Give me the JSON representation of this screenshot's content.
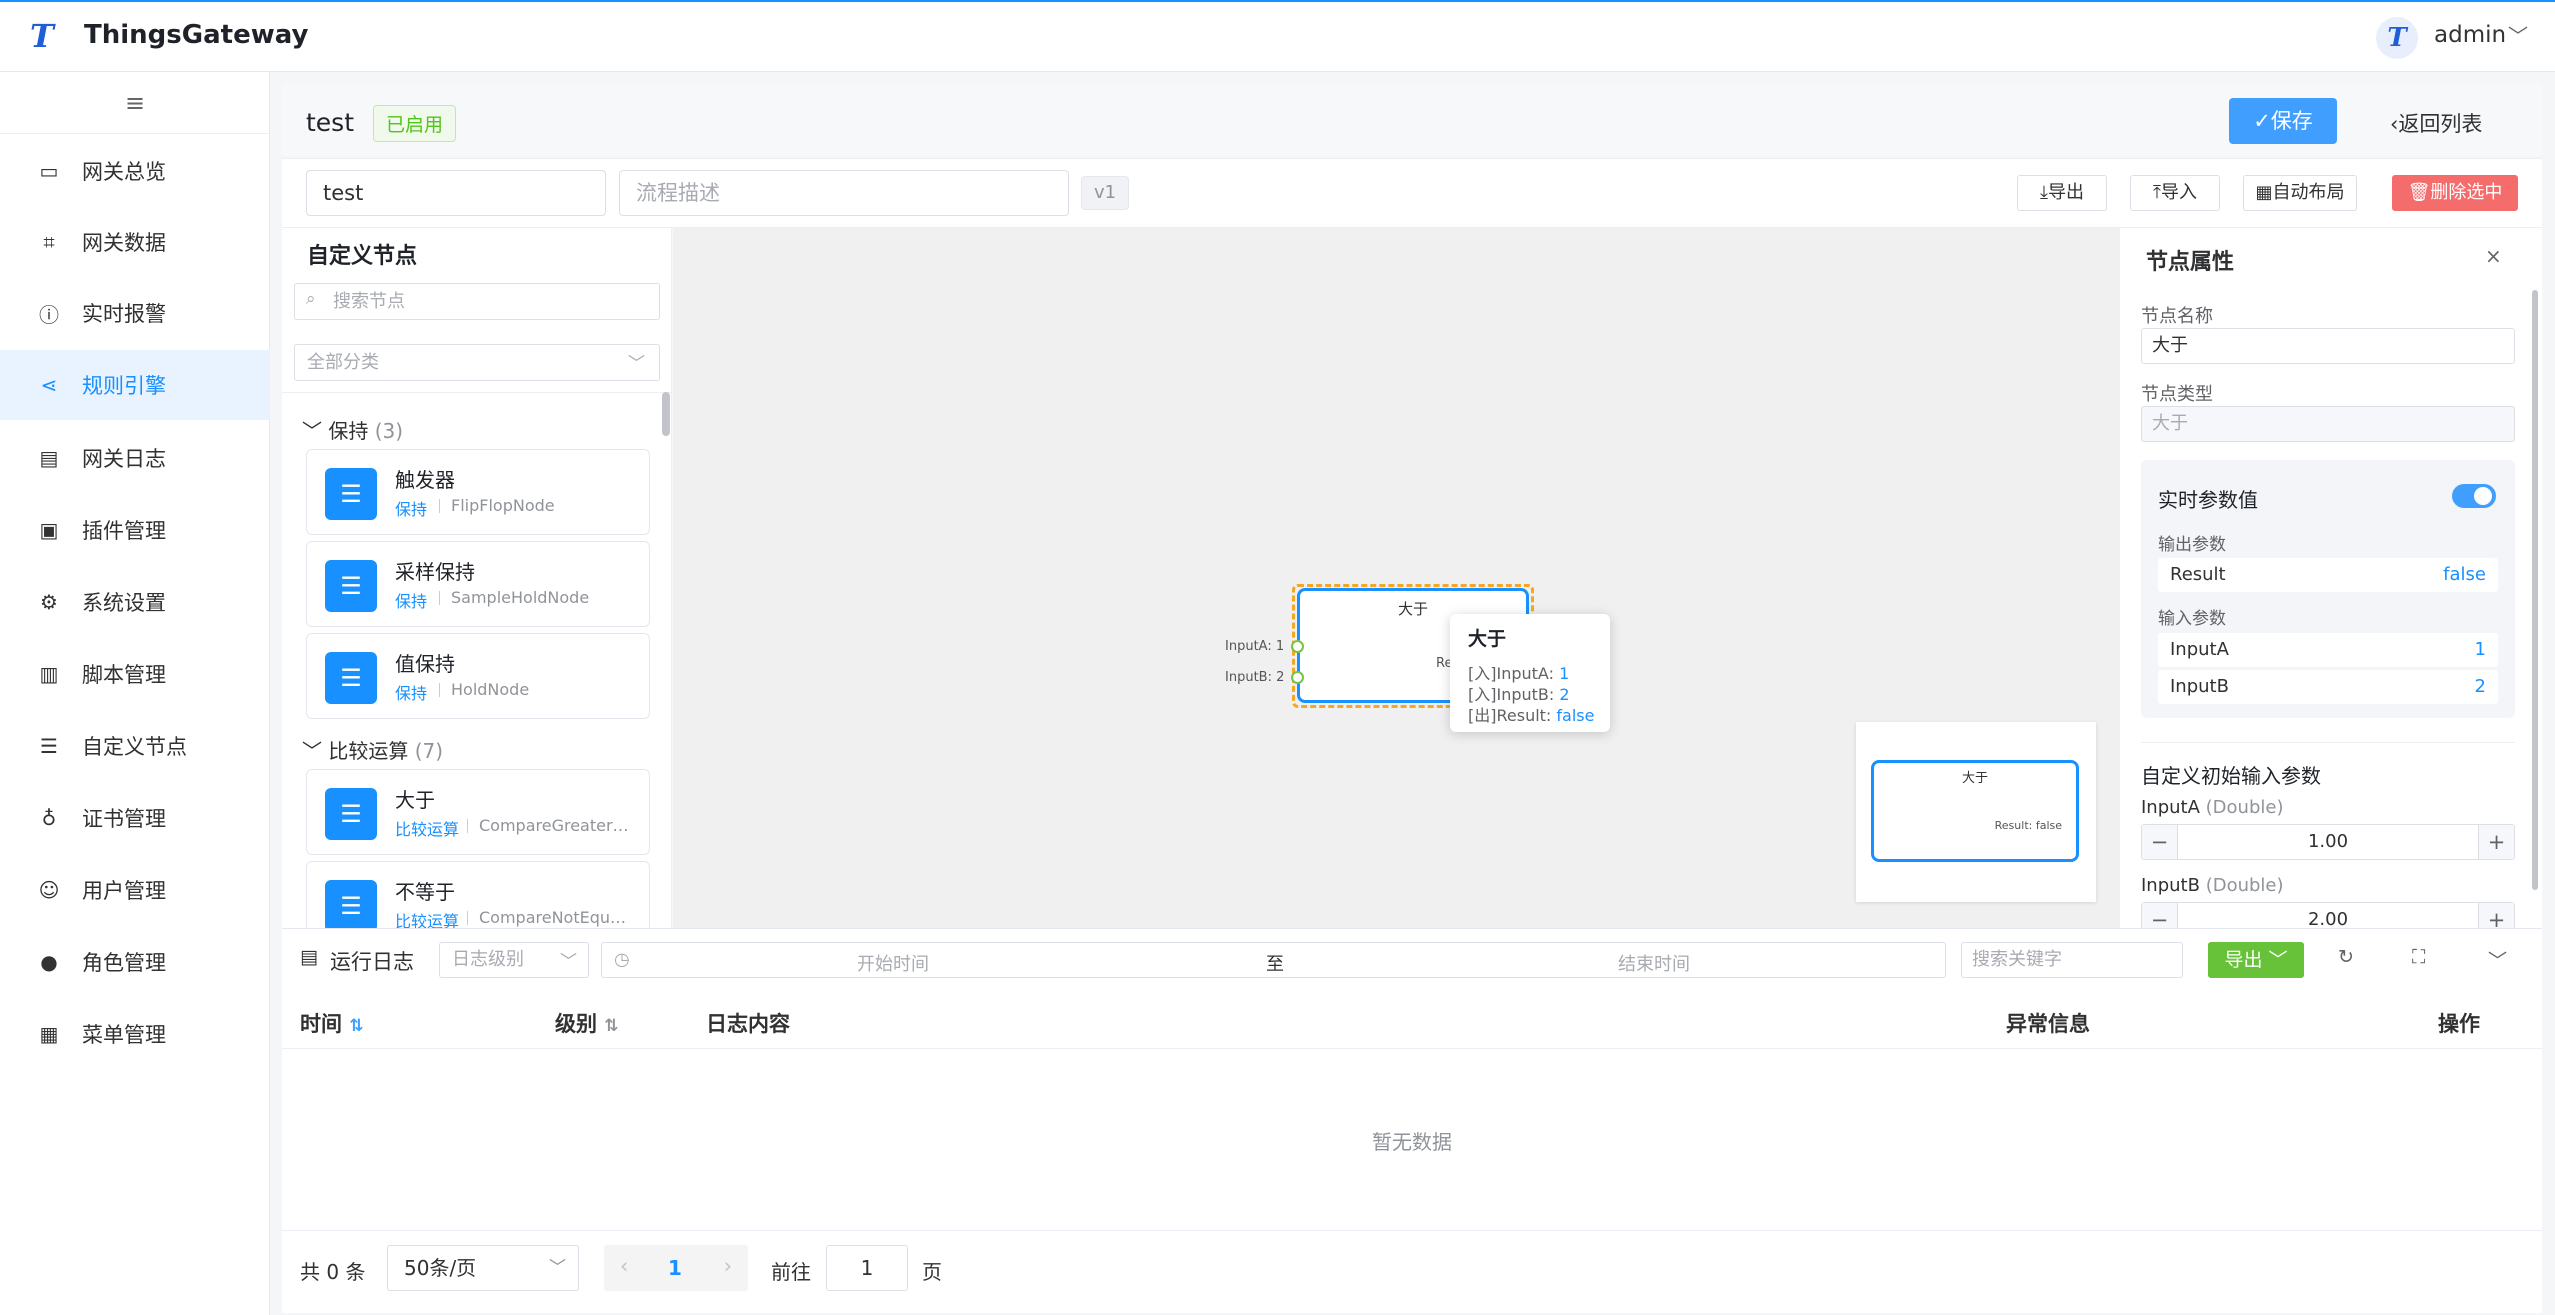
{
  "app": {
    "title": "ThingsGateway",
    "logo_glyph": "T"
  },
  "user": {
    "name": "admin",
    "avatar_glyph": "T"
  },
  "sidebar": {
    "items": [
      {
        "label": "网关总览",
        "icon": "monitor-icon"
      },
      {
        "label": "网关数据",
        "icon": "chart-board-icon"
      },
      {
        "label": "实时报警",
        "icon": "alert-icon"
      },
      {
        "label": "规则引擎",
        "icon": "share-icon",
        "active": true
      },
      {
        "label": "网关日志",
        "icon": "document-icon"
      },
      {
        "label": "插件管理",
        "icon": "package-icon"
      },
      {
        "label": "系统设置",
        "icon": "gear-icon"
      },
      {
        "label": "脚本管理",
        "icon": "script-icon"
      },
      {
        "label": "自定义节点",
        "icon": "sliders-icon"
      },
      {
        "label": "证书管理",
        "icon": "key-icon"
      },
      {
        "label": "用户管理",
        "icon": "user-icon"
      },
      {
        "label": "角色管理",
        "icon": "role-icon"
      },
      {
        "label": "菜单管理",
        "icon": "grid-icon"
      }
    ]
  },
  "header": {
    "title": "test",
    "status": "已启用",
    "save_label": "✓保存",
    "back_label": "返回列表"
  },
  "toolbar": {
    "name_value": "test",
    "desc_placeholder": "流程描述",
    "version": "v1",
    "export_label": "导出",
    "import_label": "导入",
    "autolayout_label": "自动布局",
    "delete_label": "删除选中"
  },
  "left_panel": {
    "title": "自定义节点",
    "search_placeholder": "搜索节点",
    "category_placeholder": "全部分类",
    "groups": [
      {
        "name": "保持",
        "count": "(3)"
      },
      {
        "name": "比较运算",
        "count": "(7)"
      }
    ],
    "nodes": [
      {
        "name": "触发器",
        "category": "保持",
        "class": "FlipFlopNode"
      },
      {
        "name": "采样保持",
        "category": "保持",
        "class": "SampleHoldNode"
      },
      {
        "name": "值保持",
        "category": "保持",
        "class": "HoldNode"
      },
      {
        "name": "大于",
        "category": "比较运算",
        "class": "CompareGreater…"
      },
      {
        "name": "不等于",
        "category": "比较运算",
        "class": "CompareNotEqu…"
      }
    ]
  },
  "canvas": {
    "node_title": "大于",
    "port_a": "InputA: 1",
    "port_b": "InputB: 2",
    "port_out": "Result: false",
    "tooltip": {
      "title": "大于",
      "line1_k": "[入]InputA:",
      "line1_v": "1",
      "line2_k": "[入]InputB:",
      "line2_v": "2",
      "line3_k": "[出]Result:",
      "line3_v": "false"
    },
    "minimap_title": "大于",
    "minimap_result": "Result: false"
  },
  "props": {
    "title": "节点属性",
    "name_label": "节点名称",
    "name_value": "大于",
    "type_label": "节点类型",
    "type_value": "大于",
    "realtime_title": "实时参数值",
    "realtime_on": true,
    "output_label": "输出参数",
    "outputs": [
      {
        "k": "Result",
        "v": "false"
      }
    ],
    "input_label": "输入参数",
    "inputs": [
      {
        "k": "InputA",
        "v": "1"
      },
      {
        "k": "InputB",
        "v": "2"
      }
    ],
    "custom_title": "自定义初始输入参数",
    "params": [
      {
        "name": "InputA",
        "type": "(Double)",
        "value": "1.00"
      },
      {
        "name": "InputB",
        "type": "(Double)",
        "value": "2.00"
      }
    ]
  },
  "log": {
    "title": "运行日志",
    "level_placeholder": "日志级别",
    "start_placeholder": "开始时间",
    "to": "至",
    "end_placeholder": "结束时间",
    "keyword_placeholder": "搜索关键字",
    "export_label": "导出",
    "columns": [
      "时间",
      "级别",
      "日志内容",
      "异常信息",
      "操作"
    ],
    "empty_text": "暂无数据"
  },
  "pager": {
    "total": "共 0 条",
    "page_size": "50条/页",
    "current": "1",
    "goto_label": "前往",
    "goto_value": "1",
    "page_suffix": "页"
  }
}
